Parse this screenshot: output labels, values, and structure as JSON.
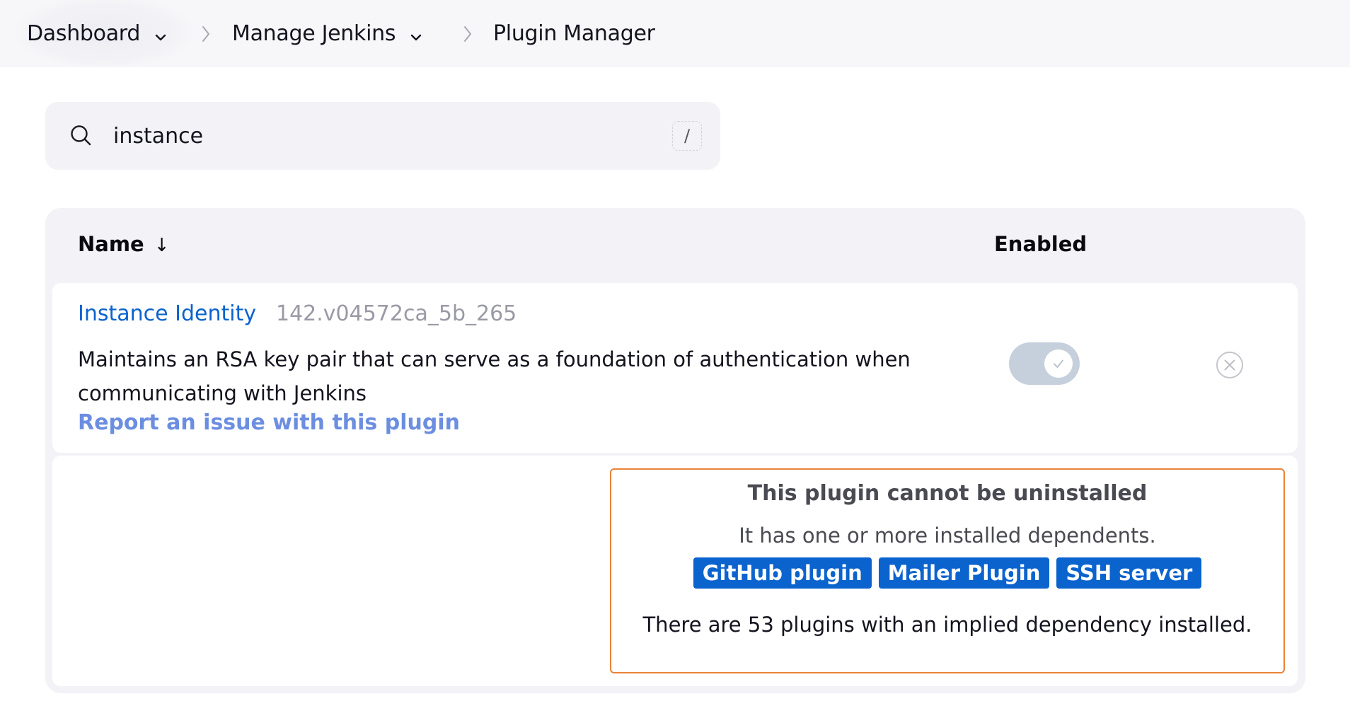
{
  "breadcrumb": {
    "items": [
      {
        "label": "Dashboard",
        "has_dropdown": true
      },
      {
        "label": "Manage Jenkins",
        "has_dropdown": true
      },
      {
        "label": "Plugin Manager",
        "has_dropdown": false
      }
    ],
    "separator_icon": "chevron-right-icon",
    "dropdown_icon": "chevron-down-icon"
  },
  "search": {
    "icon": "search-icon",
    "value": "instance",
    "placeholder": "Search",
    "shortcut_hint": "/"
  },
  "table": {
    "columns": [
      {
        "label": "Name",
        "sort_indicator": "↓"
      },
      {
        "label": "Enabled"
      }
    ],
    "rows": [
      {
        "name": "Instance Identity",
        "version": "142.v04572ca_5b_265",
        "description": "Maintains an RSA key pair that can serve as a foundation of authentication when communicating with Jenkins",
        "report_link": "Report an issue with this plugin",
        "enabled": true,
        "enabled_toggle_disabled": true,
        "uninstall_icon": "x-circle-icon",
        "dependency_notice": {
          "title": "This plugin cannot be uninstalled",
          "subtitle": "It has one or more installed dependents.",
          "dependents": [
            "GitHub plugin",
            "Mailer Plugin",
            "SSH server"
          ],
          "implied_text": "There are 53 plugins with an implied dependency installed."
        }
      }
    ]
  },
  "colors": {
    "link": "#0b63ce",
    "report_link": "#6c8ee0",
    "warning_border": "#e8833a",
    "toggle_bg": "#c5d0dc",
    "surface": "#f2f2f7",
    "header_bg": "#f7f7f9"
  }
}
